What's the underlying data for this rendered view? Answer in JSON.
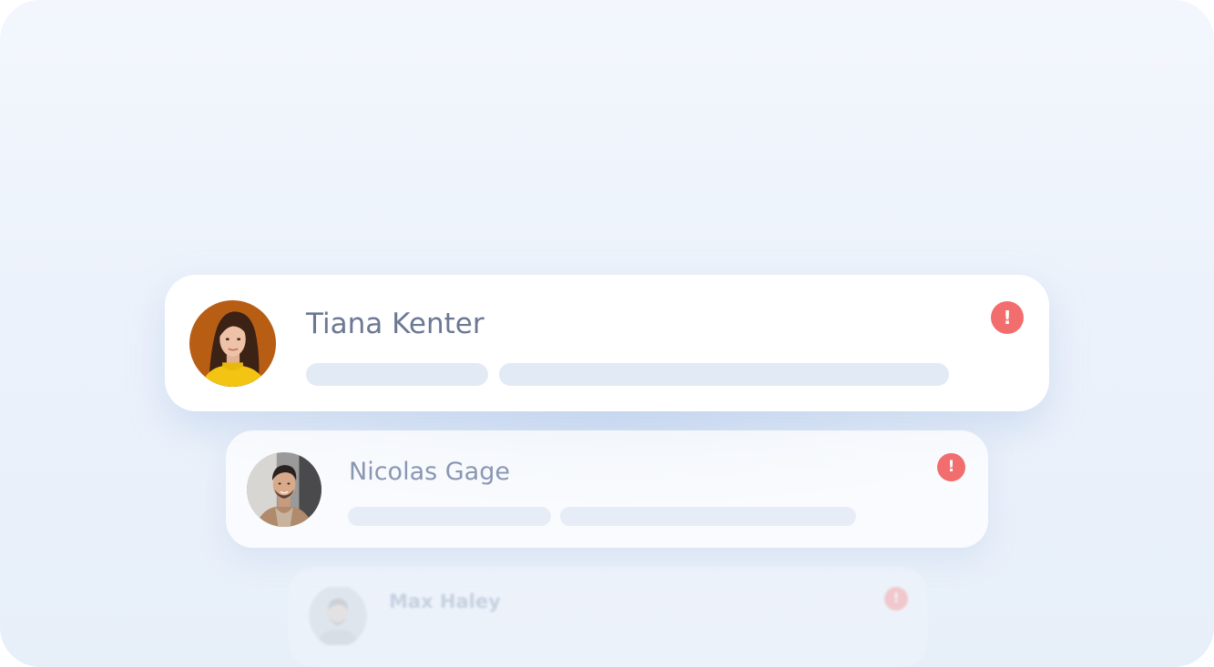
{
  "notifications": [
    {
      "name": "Tiana Kenter",
      "avatar_icon": "woman-portrait-avatar",
      "alert_icon": "alert-exclamation-icon",
      "alert_symbol": "!",
      "alert_color": "#f26d6d"
    },
    {
      "name": "Nicolas Gage",
      "avatar_icon": "man-portrait-avatar",
      "alert_icon": "alert-exclamation-icon",
      "alert_symbol": "!",
      "alert_color": "#f26d6d"
    },
    {
      "name": "Max Haley",
      "avatar_icon": "man-portrait-avatar",
      "alert_icon": "alert-exclamation-icon",
      "alert_symbol": "!",
      "alert_color": "#f7a8a8"
    }
  ],
  "colors": {
    "background": "#eef3fb",
    "card": "#ffffff",
    "placeholder": "#e2eaf5",
    "name_text": "#6c7894",
    "alert": "#f26d6d"
  }
}
